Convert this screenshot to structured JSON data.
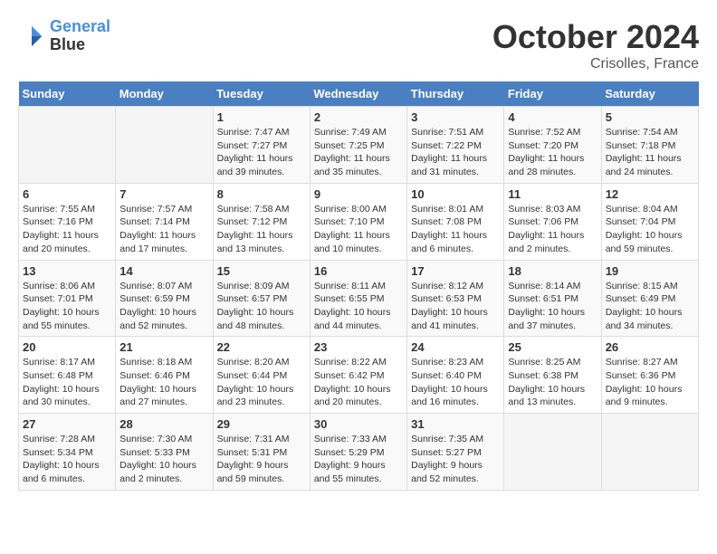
{
  "header": {
    "logo_line1": "General",
    "logo_line2": "Blue",
    "month": "October 2024",
    "location": "Crisolles, France"
  },
  "weekdays": [
    "Sunday",
    "Monday",
    "Tuesday",
    "Wednesday",
    "Thursday",
    "Friday",
    "Saturday"
  ],
  "weeks": [
    [
      {
        "day": "",
        "info": ""
      },
      {
        "day": "",
        "info": ""
      },
      {
        "day": "1",
        "info": "Sunrise: 7:47 AM\nSunset: 7:27 PM\nDaylight: 11 hours and 39 minutes."
      },
      {
        "day": "2",
        "info": "Sunrise: 7:49 AM\nSunset: 7:25 PM\nDaylight: 11 hours and 35 minutes."
      },
      {
        "day": "3",
        "info": "Sunrise: 7:51 AM\nSunset: 7:22 PM\nDaylight: 11 hours and 31 minutes."
      },
      {
        "day": "4",
        "info": "Sunrise: 7:52 AM\nSunset: 7:20 PM\nDaylight: 11 hours and 28 minutes."
      },
      {
        "day": "5",
        "info": "Sunrise: 7:54 AM\nSunset: 7:18 PM\nDaylight: 11 hours and 24 minutes."
      }
    ],
    [
      {
        "day": "6",
        "info": "Sunrise: 7:55 AM\nSunset: 7:16 PM\nDaylight: 11 hours and 20 minutes."
      },
      {
        "day": "7",
        "info": "Sunrise: 7:57 AM\nSunset: 7:14 PM\nDaylight: 11 hours and 17 minutes."
      },
      {
        "day": "8",
        "info": "Sunrise: 7:58 AM\nSunset: 7:12 PM\nDaylight: 11 hours and 13 minutes."
      },
      {
        "day": "9",
        "info": "Sunrise: 8:00 AM\nSunset: 7:10 PM\nDaylight: 11 hours and 10 minutes."
      },
      {
        "day": "10",
        "info": "Sunrise: 8:01 AM\nSunset: 7:08 PM\nDaylight: 11 hours and 6 minutes."
      },
      {
        "day": "11",
        "info": "Sunrise: 8:03 AM\nSunset: 7:06 PM\nDaylight: 11 hours and 2 minutes."
      },
      {
        "day": "12",
        "info": "Sunrise: 8:04 AM\nSunset: 7:04 PM\nDaylight: 10 hours and 59 minutes."
      }
    ],
    [
      {
        "day": "13",
        "info": "Sunrise: 8:06 AM\nSunset: 7:01 PM\nDaylight: 10 hours and 55 minutes."
      },
      {
        "day": "14",
        "info": "Sunrise: 8:07 AM\nSunset: 6:59 PM\nDaylight: 10 hours and 52 minutes."
      },
      {
        "day": "15",
        "info": "Sunrise: 8:09 AM\nSunset: 6:57 PM\nDaylight: 10 hours and 48 minutes."
      },
      {
        "day": "16",
        "info": "Sunrise: 8:11 AM\nSunset: 6:55 PM\nDaylight: 10 hours and 44 minutes."
      },
      {
        "day": "17",
        "info": "Sunrise: 8:12 AM\nSunset: 6:53 PM\nDaylight: 10 hours and 41 minutes."
      },
      {
        "day": "18",
        "info": "Sunrise: 8:14 AM\nSunset: 6:51 PM\nDaylight: 10 hours and 37 minutes."
      },
      {
        "day": "19",
        "info": "Sunrise: 8:15 AM\nSunset: 6:49 PM\nDaylight: 10 hours and 34 minutes."
      }
    ],
    [
      {
        "day": "20",
        "info": "Sunrise: 8:17 AM\nSunset: 6:48 PM\nDaylight: 10 hours and 30 minutes."
      },
      {
        "day": "21",
        "info": "Sunrise: 8:18 AM\nSunset: 6:46 PM\nDaylight: 10 hours and 27 minutes."
      },
      {
        "day": "22",
        "info": "Sunrise: 8:20 AM\nSunset: 6:44 PM\nDaylight: 10 hours and 23 minutes."
      },
      {
        "day": "23",
        "info": "Sunrise: 8:22 AM\nSunset: 6:42 PM\nDaylight: 10 hours and 20 minutes."
      },
      {
        "day": "24",
        "info": "Sunrise: 8:23 AM\nSunset: 6:40 PM\nDaylight: 10 hours and 16 minutes."
      },
      {
        "day": "25",
        "info": "Sunrise: 8:25 AM\nSunset: 6:38 PM\nDaylight: 10 hours and 13 minutes."
      },
      {
        "day": "26",
        "info": "Sunrise: 8:27 AM\nSunset: 6:36 PM\nDaylight: 10 hours and 9 minutes."
      }
    ],
    [
      {
        "day": "27",
        "info": "Sunrise: 7:28 AM\nSunset: 5:34 PM\nDaylight: 10 hours and 6 minutes."
      },
      {
        "day": "28",
        "info": "Sunrise: 7:30 AM\nSunset: 5:33 PM\nDaylight: 10 hours and 2 minutes."
      },
      {
        "day": "29",
        "info": "Sunrise: 7:31 AM\nSunset: 5:31 PM\nDaylight: 9 hours and 59 minutes."
      },
      {
        "day": "30",
        "info": "Sunrise: 7:33 AM\nSunset: 5:29 PM\nDaylight: 9 hours and 55 minutes."
      },
      {
        "day": "31",
        "info": "Sunrise: 7:35 AM\nSunset: 5:27 PM\nDaylight: 9 hours and 52 minutes."
      },
      {
        "day": "",
        "info": ""
      },
      {
        "day": "",
        "info": ""
      }
    ]
  ]
}
